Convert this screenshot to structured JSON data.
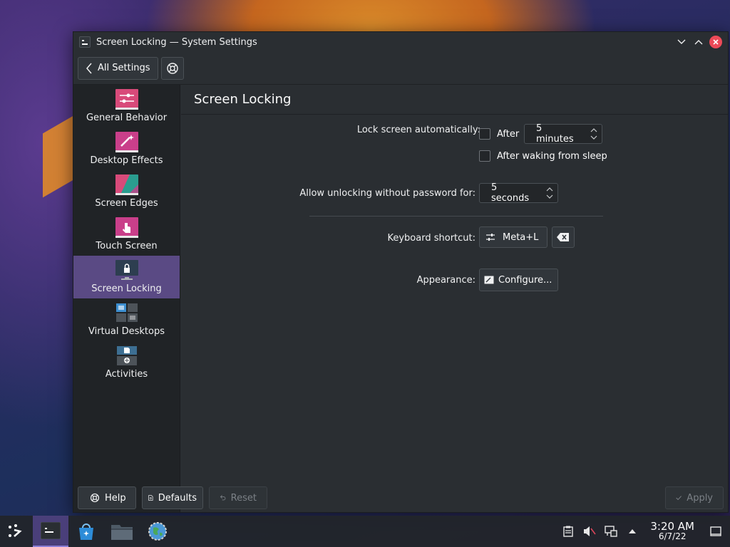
{
  "window": {
    "title": "Screen Locking — System Settings"
  },
  "toolbar": {
    "back_label": "All Settings"
  },
  "sidebar": {
    "items": [
      {
        "label": "General Behavior",
        "icon": "general-behavior-icon"
      },
      {
        "label": "Desktop Effects",
        "icon": "desktop-effects-icon"
      },
      {
        "label": "Screen Edges",
        "icon": "screen-edges-icon"
      },
      {
        "label": "Touch Screen",
        "icon": "touch-screen-icon"
      },
      {
        "label": "Screen Locking",
        "icon": "screen-locking-icon",
        "active": true
      },
      {
        "label": "Virtual Desktops",
        "icon": "virtual-desktops-icon"
      },
      {
        "label": "Activities",
        "icon": "activities-icon"
      }
    ]
  },
  "main": {
    "header": "Screen Locking",
    "lock_auto_label": "Lock screen automatically:",
    "after_label": "After",
    "after_value": "5 minutes",
    "after_waking_label": "After waking from sleep",
    "allow_unlock_label": "Allow unlocking without password for:",
    "allow_unlock_value": "5 seconds",
    "shortcut_label": "Keyboard shortcut:",
    "shortcut_value": "Meta+L",
    "appearance_label": "Appearance:",
    "configure_label": "Configure..."
  },
  "bottom": {
    "help_label": "Help",
    "defaults_label": "Defaults",
    "reset_label": "Reset",
    "apply_label": "Apply"
  },
  "taskbar": {
    "time": "3:20 AM",
    "date": "6/7/22"
  },
  "colors": {
    "accent": "#5a4a84",
    "close": "#ec4a58",
    "window_bg": "#2a2e32",
    "sidebar_bg": "#202326"
  }
}
